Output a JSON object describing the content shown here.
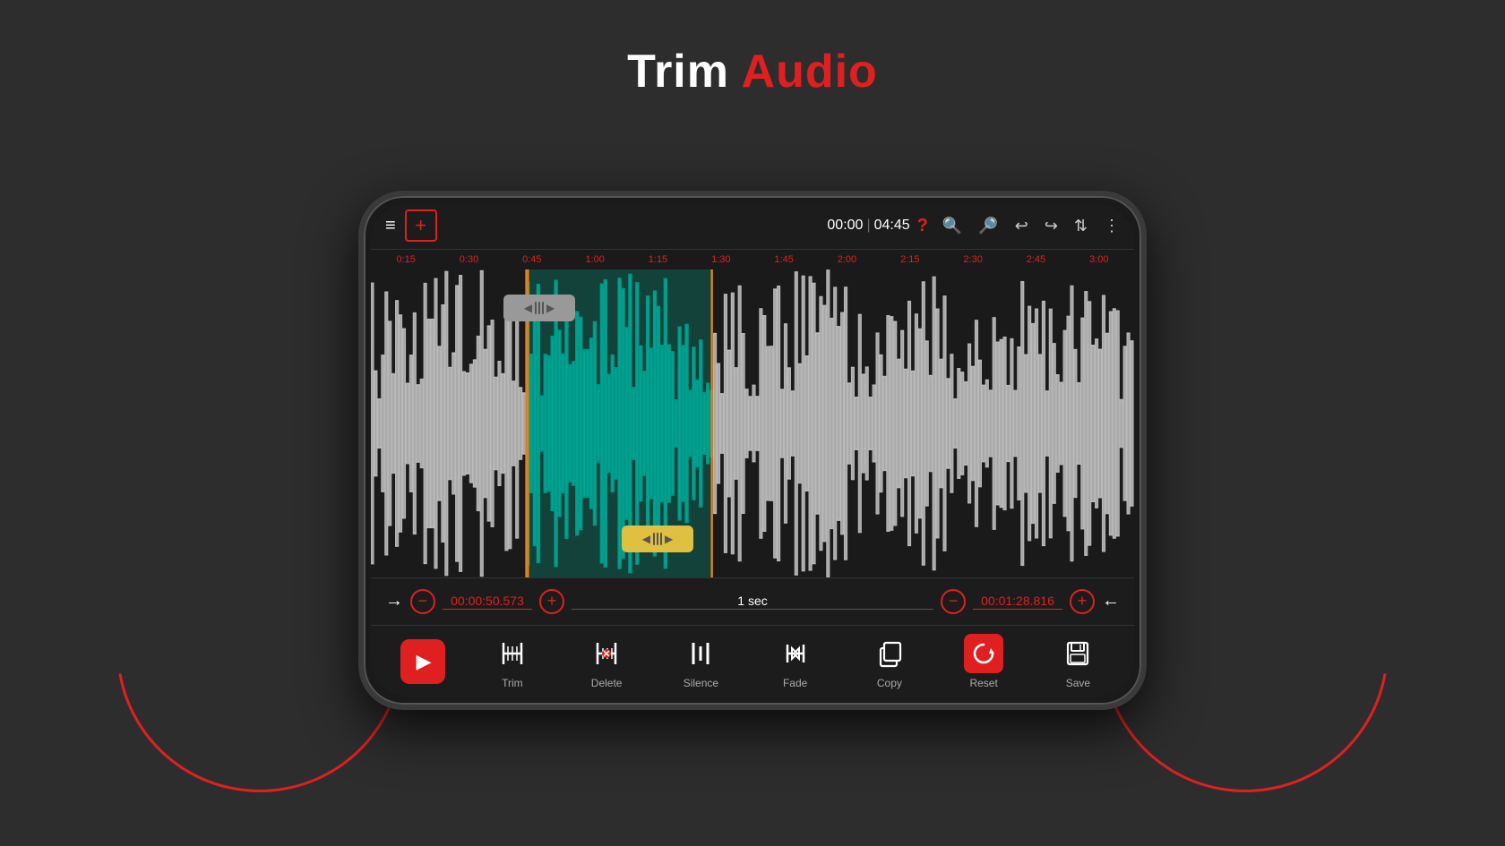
{
  "page": {
    "title_normal": "Trim ",
    "title_highlight": "Audio",
    "bg_color": "#2d2d2d",
    "accent_color": "#e02020"
  },
  "topbar": {
    "time_current": "00:00",
    "time_total": "04:45",
    "question_label": "?",
    "menu_icon": "≡",
    "add_label": "+"
  },
  "timeline_marks": [
    "0:15",
    "0:30",
    "0:45",
    "1:00",
    "1:15",
    "1:30",
    "1:45",
    "2:00",
    "2:15",
    "2:30",
    "2:45",
    "3:00"
  ],
  "controls": {
    "start_time": "00:00:50.573",
    "end_time": "00:01:28.816",
    "step_label": "1 sec"
  },
  "toolbar": {
    "play_label": "",
    "trim_label": "Trim",
    "delete_label": "Delete",
    "silence_label": "Silence",
    "fade_label": "Fade",
    "copy_label": "Copy",
    "reset_label": "Reset",
    "save_label": "Save"
  },
  "icons": {
    "menu": "≡",
    "add": "+",
    "zoom_in": "🔍",
    "zoom_out": "🔍",
    "undo": "↩",
    "redo": "↪",
    "sort": "⇅",
    "more": "⋮",
    "play": "▶",
    "trim": "⊢⊣",
    "delete": "✂",
    "silence": "Ⅱ",
    "fade": "◁▷",
    "copy": "⊞",
    "reset": "↺",
    "save": "💾",
    "arrow_right": "→",
    "arrow_left": "←",
    "minus": "−",
    "plus": "+"
  }
}
